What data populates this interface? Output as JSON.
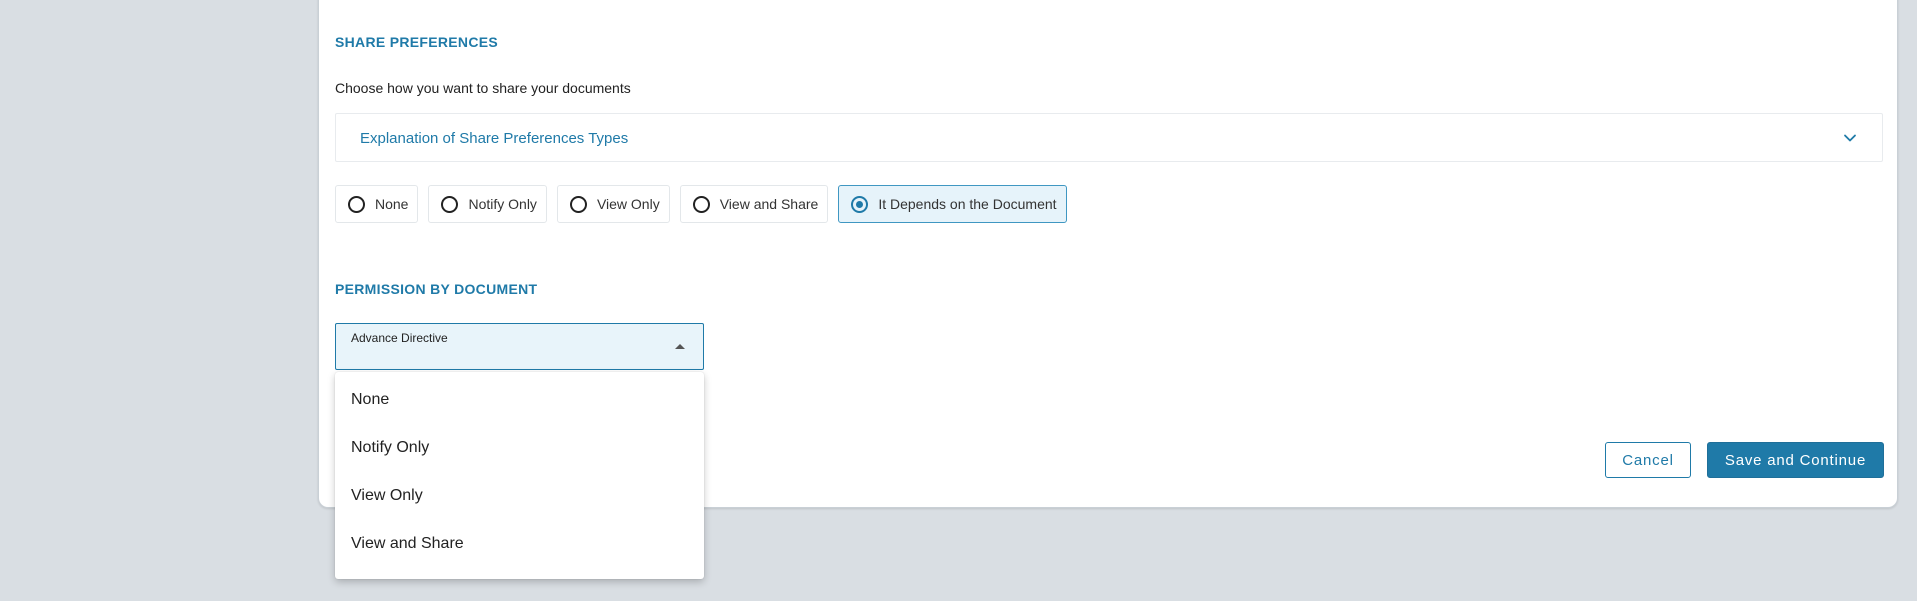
{
  "share_preferences": {
    "title": "SHARE PREFERENCES",
    "description": "Choose how you want to share your documents",
    "accordion_label": "Explanation of Share Preferences Types",
    "options": [
      {
        "label": "None",
        "selected": false
      },
      {
        "label": "Notify Only",
        "selected": false
      },
      {
        "label": "View Only",
        "selected": false
      },
      {
        "label": "View and Share",
        "selected": false
      },
      {
        "label": "It Depends on the Document",
        "selected": true
      }
    ]
  },
  "permission_by_document": {
    "title": "PERMISSION BY DOCUMENT",
    "select_label": "Advance Directive",
    "dropdown_options": [
      "None",
      "Notify Only",
      "View Only",
      "View and Share"
    ]
  },
  "actions": {
    "cancel_label": "Cancel",
    "save_label": "Save and Continue"
  },
  "colors": {
    "accent": "#1f7aa8",
    "background": "#d9dee3",
    "selected_fill": "#e6f3fa"
  }
}
